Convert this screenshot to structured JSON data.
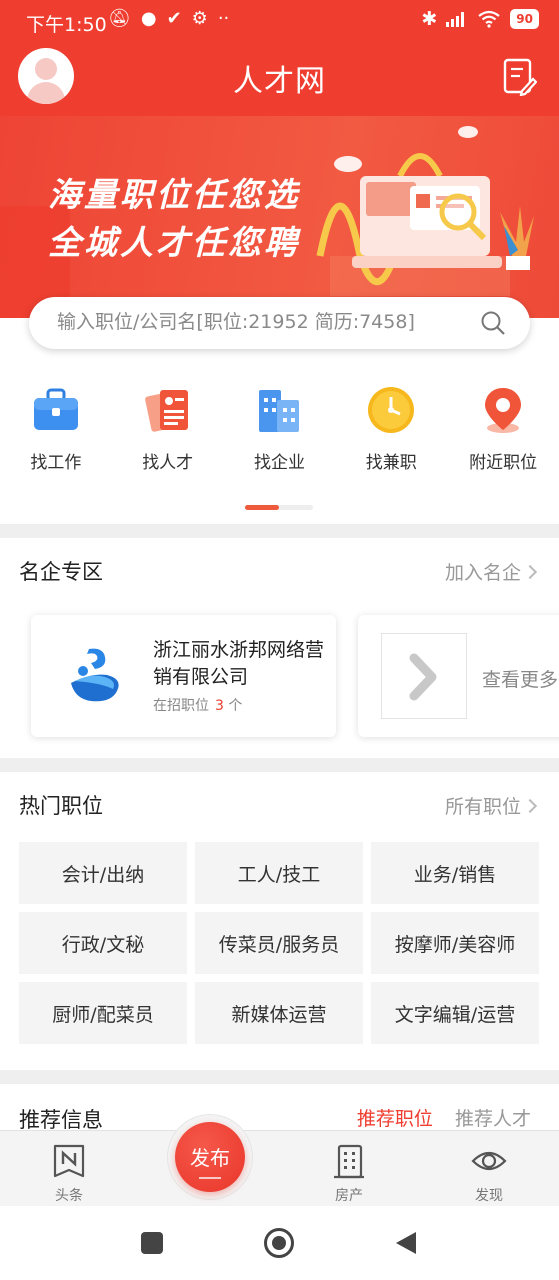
{
  "status_bar": {
    "time": "下午1:50",
    "battery": "90"
  },
  "header": {
    "title": "人才网"
  },
  "banner": {
    "line1": "海量职位任您选",
    "line2": "全城人才任您聘"
  },
  "search": {
    "placeholder": "输入职位/公司名[职位:21952 简历:7458]"
  },
  "nav": [
    {
      "label": "找工作",
      "icon": "briefcase-icon"
    },
    {
      "label": "找人才",
      "icon": "resume-icon"
    },
    {
      "label": "找企业",
      "icon": "building-icon"
    },
    {
      "label": "找兼职",
      "icon": "clock-icon"
    },
    {
      "label": "附近职位",
      "icon": "location-pin-icon"
    }
  ],
  "famous": {
    "title": "名企专区",
    "link": "加入名企",
    "company": {
      "name": "浙江丽水浙邦网络营销有限公司",
      "meta_label": "在招职位",
      "meta_count": "3",
      "meta_unit": "个"
    },
    "more_label": "查看更多"
  },
  "hot_jobs": {
    "title": "热门职位",
    "link": "所有职位",
    "items": [
      "会计/出纳",
      "工人/技工",
      "业务/销售",
      "行政/文秘",
      "传菜员/服务员",
      "按摩师/美容师",
      "厨师/配菜员",
      "新媒体运营",
      "文字编辑/运营"
    ]
  },
  "recommend": {
    "title": "推荐信息",
    "tab_active": "推荐职位",
    "tab_inactive": "推荐人才"
  },
  "tabbar": {
    "items": [
      {
        "label": "头条",
        "icon": "news-icon"
      },
      {
        "label": "房产",
        "icon": "building-grid-icon"
      },
      {
        "label": "发现",
        "icon": "eye-icon"
      }
    ],
    "publish": "发布"
  },
  "colors": {
    "brand": "#ef3d30",
    "accent_orange": "#f05a3c"
  }
}
